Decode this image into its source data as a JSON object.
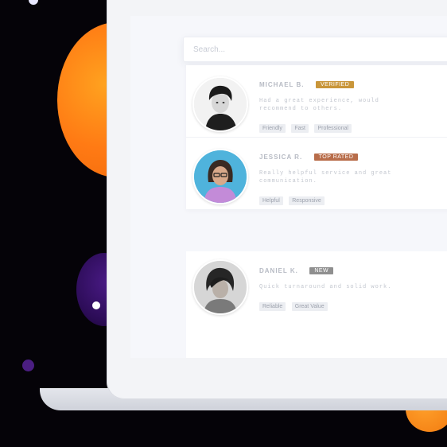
{
  "theme": {
    "accent_orange": "#ff8a16",
    "accent_purple": "#3b1470",
    "background": "#050308"
  },
  "search": {
    "placeholder": "Search..."
  },
  "reviews": [
    {
      "avatar_icon": "man-avatar",
      "name": "MICHAEL B.",
      "tag": "VERIFIED",
      "tag_color": "#c9963a",
      "text": "Had a great experience, would recommend to others.",
      "chips": [
        "Friendly",
        "Fast",
        "Professional"
      ]
    },
    {
      "avatar_icon": "woman-avatar",
      "name": "JESSICA R.",
      "tag": "TOP RATED",
      "tag_color": "#b86d4a",
      "text": "Really helpful service and great communication.",
      "chips": [
        "Helpful",
        "Responsive"
      ]
    },
    {
      "avatar_icon": "person-avatar",
      "name": "DANIEL K.",
      "tag": "NEW",
      "tag_color": "#8f8f8f",
      "text": "Quick turnaround and solid work.",
      "chips": [
        "Reliable",
        "Great Value"
      ]
    }
  ]
}
